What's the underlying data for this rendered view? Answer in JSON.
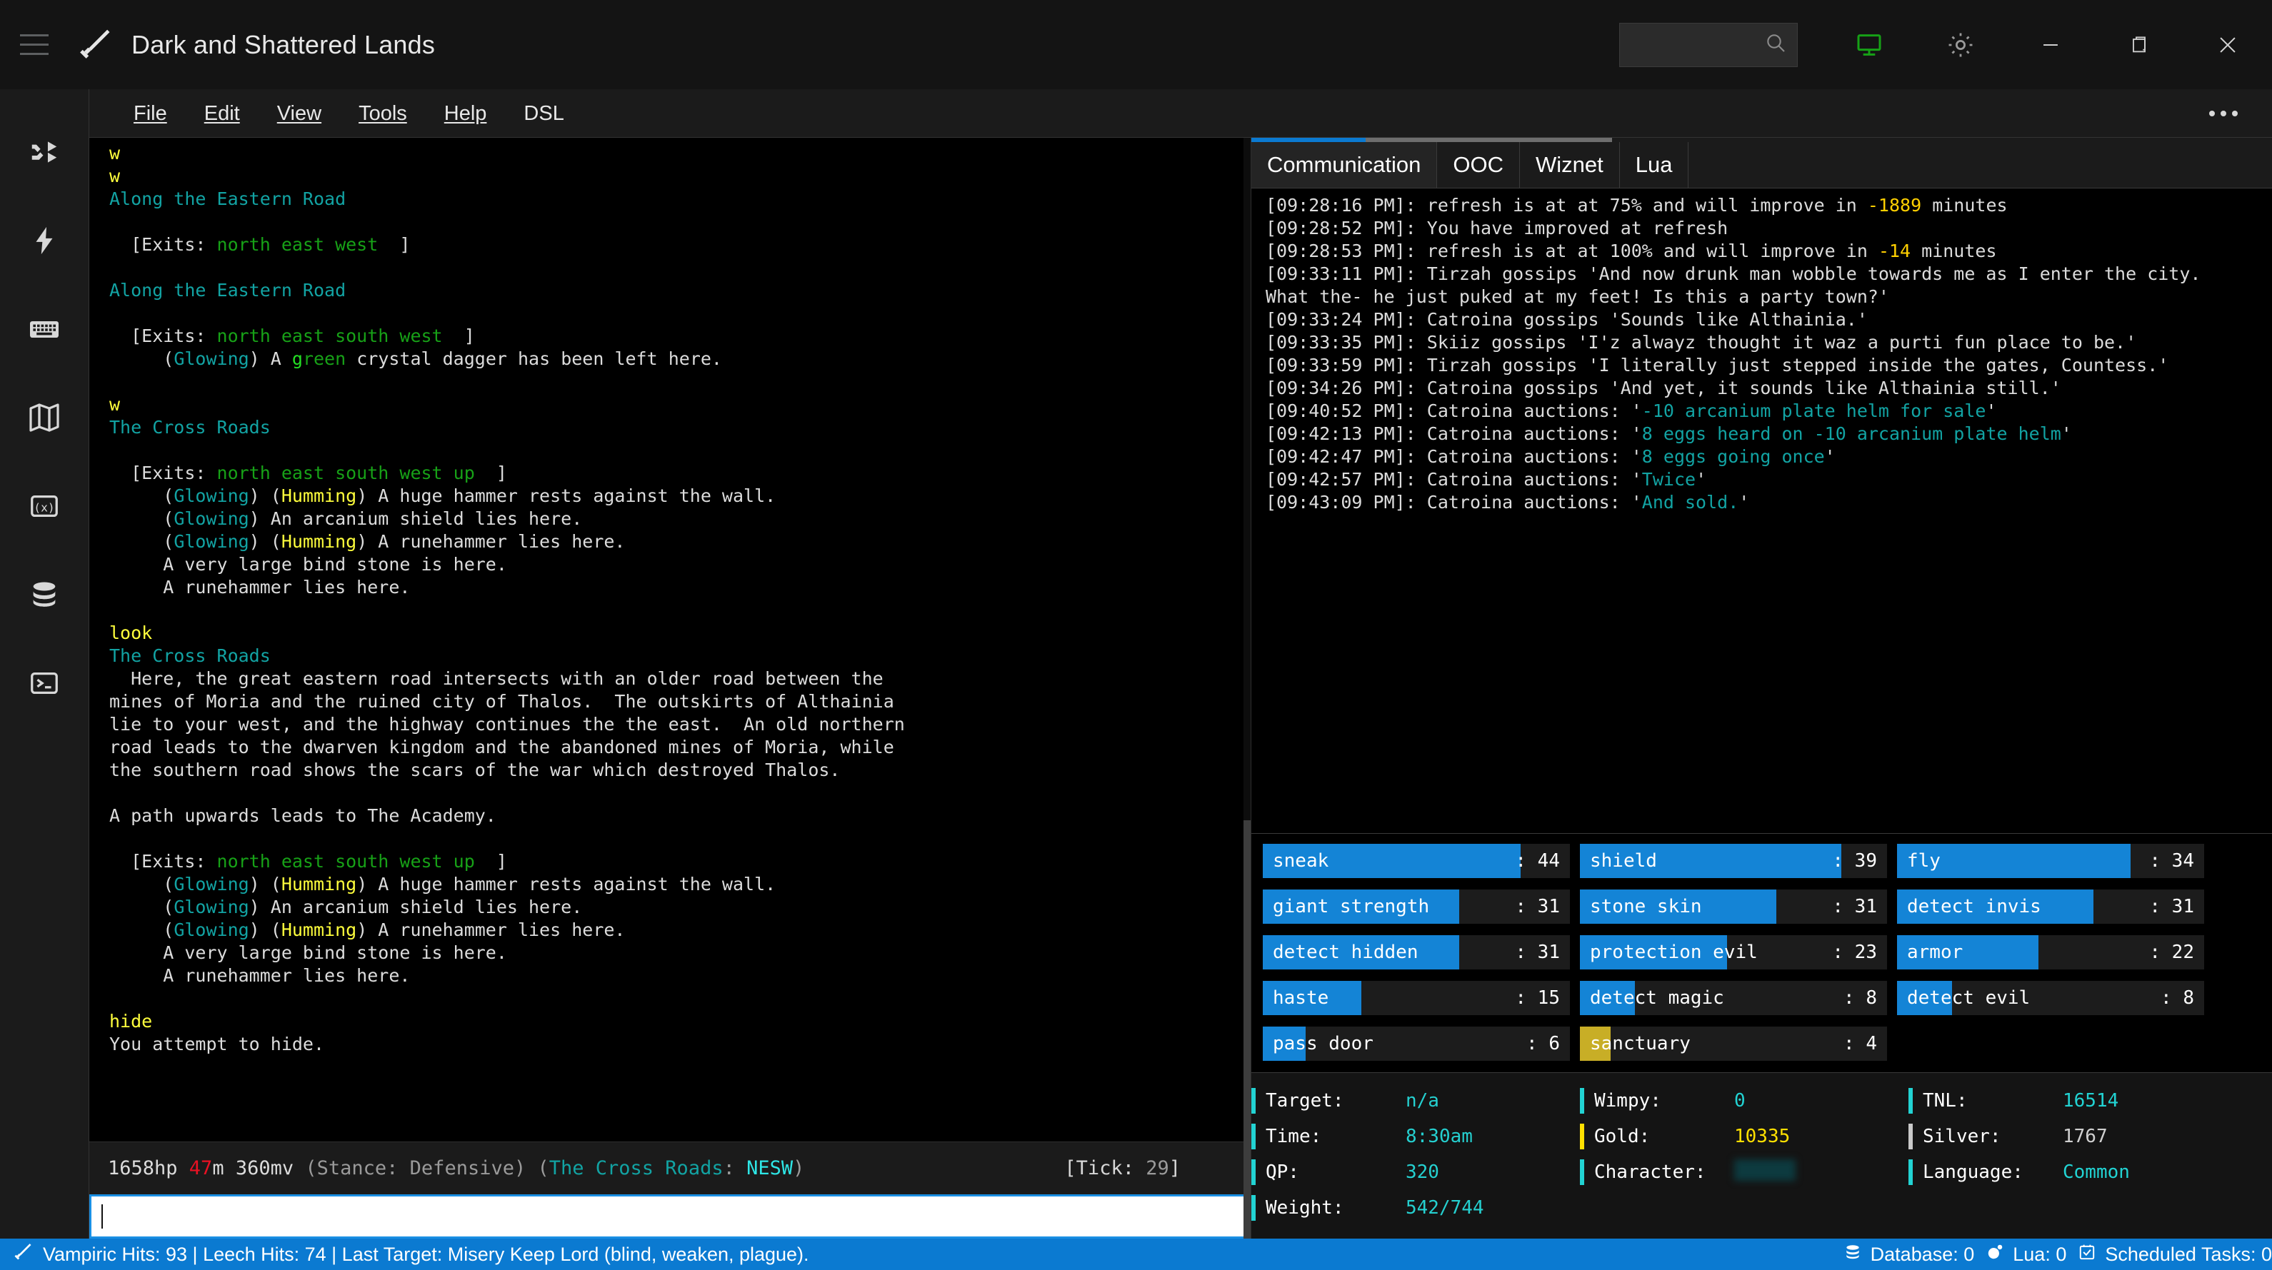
{
  "window": {
    "title": "Dark and Shattered Lands",
    "logo_icon": "sword-icon",
    "hamburger_icon": "hamburger-menu-icon",
    "search_placeholder": "",
    "search_value": "",
    "search_icon": "search-icon",
    "screen_icon": "remote-screen-icon",
    "settings_icon": "gear-icon",
    "minimize_icon": "minimize-icon",
    "restore_icon": "restore-icon",
    "close_icon": "close-icon"
  },
  "rail": {
    "items": [
      {
        "icon": "shuffle-icon",
        "name": "aliases"
      },
      {
        "icon": "lightning-bolt-icon",
        "name": "triggers"
      },
      {
        "icon": "keyboard-icon",
        "name": "keys"
      },
      {
        "icon": "map-icon",
        "name": "mapper"
      },
      {
        "icon": "variable-icon",
        "name": "variables"
      },
      {
        "icon": "database-icon",
        "name": "database"
      },
      {
        "icon": "terminal-icon",
        "name": "lua-console"
      }
    ]
  },
  "menubar": {
    "items": [
      "File",
      "Edit",
      "View",
      "Tools",
      "Help",
      "DSL"
    ],
    "overflow_icon": "ellipsis-icon"
  },
  "mud_output": {
    "lines": [
      [
        {
          "t": "w",
          "c": "c-yellow"
        }
      ],
      [
        {
          "t": "w",
          "c": "c-yellow"
        }
      ],
      [
        {
          "t": "Along the Eastern Road",
          "c": "c-teal"
        }
      ],
      [
        {
          "t": "",
          "c": "c-white"
        }
      ],
      [
        {
          "t": "  [Exits: ",
          "c": "c-white"
        },
        {
          "t": "north east west",
          "c": "c-green"
        },
        {
          "t": "  ]",
          "c": "c-white"
        }
      ],
      [
        {
          "t": "",
          "c": "c-white"
        }
      ],
      [
        {
          "t": "Along the Eastern Road",
          "c": "c-teal"
        }
      ],
      [
        {
          "t": "",
          "c": "c-white"
        }
      ],
      [
        {
          "t": "  [Exits: ",
          "c": "c-white"
        },
        {
          "t": "north east south west",
          "c": "c-green"
        },
        {
          "t": "  ]",
          "c": "c-white"
        }
      ],
      [
        {
          "t": "     (",
          "c": "c-white"
        },
        {
          "t": "Glowing",
          "c": "c-teal"
        },
        {
          "t": ") A ",
          "c": "c-white"
        },
        {
          "t": "g",
          "c": "c-bgreen"
        },
        {
          "t": "reen",
          "c": "c-green"
        },
        {
          "t": " crystal dagger has been left here.",
          "c": "c-white"
        }
      ],
      [
        {
          "t": "",
          "c": "c-white"
        }
      ],
      [
        {
          "t": "w",
          "c": "c-yellow"
        }
      ],
      [
        {
          "t": "The Cross Roads",
          "c": "c-teal"
        }
      ],
      [
        {
          "t": "",
          "c": "c-white"
        }
      ],
      [
        {
          "t": "  [Exits: ",
          "c": "c-white"
        },
        {
          "t": "north east south west up",
          "c": "c-green"
        },
        {
          "t": "  ]",
          "c": "c-white"
        }
      ],
      [
        {
          "t": "     (",
          "c": "c-white"
        },
        {
          "t": "Glowing",
          "c": "c-teal"
        },
        {
          "t": ") (",
          "c": "c-white"
        },
        {
          "t": "Humming",
          "c": "c-yellow"
        },
        {
          "t": ") A huge hammer rests against the wall.",
          "c": "c-white"
        }
      ],
      [
        {
          "t": "     (",
          "c": "c-white"
        },
        {
          "t": "Glowing",
          "c": "c-teal"
        },
        {
          "t": ") An arcanium shield lies here.",
          "c": "c-white"
        }
      ],
      [
        {
          "t": "     (",
          "c": "c-white"
        },
        {
          "t": "Glowing",
          "c": "c-teal"
        },
        {
          "t": ") (",
          "c": "c-white"
        },
        {
          "t": "Humming",
          "c": "c-yellow"
        },
        {
          "t": ") A runehammer lies here.",
          "c": "c-white"
        }
      ],
      [
        {
          "t": "     A very large bind stone is here.",
          "c": "c-white"
        }
      ],
      [
        {
          "t": "     A runehammer lies here.",
          "c": "c-white"
        }
      ],
      [
        {
          "t": "",
          "c": "c-white"
        }
      ],
      [
        {
          "t": "look",
          "c": "c-yellow"
        }
      ],
      [
        {
          "t": "The Cross Roads",
          "c": "c-teal"
        }
      ],
      [
        {
          "t": "  Here, the great eastern road intersects with an older road between the",
          "c": "c-white"
        }
      ],
      [
        {
          "t": "mines of Moria and the ruined city of Thalos.  The outskirts of Althainia",
          "c": "c-white"
        }
      ],
      [
        {
          "t": "lie to your west, and the highway continues the the east.  An old northern",
          "c": "c-white"
        }
      ],
      [
        {
          "t": "road leads to the dwarven kingdom and the abandoned mines of Moria, while",
          "c": "c-white"
        }
      ],
      [
        {
          "t": "the southern road shows the scars of the war which destroyed Thalos.",
          "c": "c-white"
        }
      ],
      [
        {
          "t": "",
          "c": "c-white"
        }
      ],
      [
        {
          "t": "A path upwards leads to The Academy.",
          "c": "c-white"
        }
      ],
      [
        {
          "t": "",
          "c": "c-white"
        }
      ],
      [
        {
          "t": "  [Exits: ",
          "c": "c-white"
        },
        {
          "t": "north east south west up",
          "c": "c-green"
        },
        {
          "t": "  ]",
          "c": "c-white"
        }
      ],
      [
        {
          "t": "     (",
          "c": "c-white"
        },
        {
          "t": "Glowing",
          "c": "c-teal"
        },
        {
          "t": ") (",
          "c": "c-white"
        },
        {
          "t": "Humming",
          "c": "c-yellow"
        },
        {
          "t": ") A huge hammer rests against the wall.",
          "c": "c-white"
        }
      ],
      [
        {
          "t": "     (",
          "c": "c-white"
        },
        {
          "t": "Glowing",
          "c": "c-teal"
        },
        {
          "t": ") An arcanium shield lies here.",
          "c": "c-white"
        }
      ],
      [
        {
          "t": "     (",
          "c": "c-white"
        },
        {
          "t": "Glowing",
          "c": "c-teal"
        },
        {
          "t": ") (",
          "c": "c-white"
        },
        {
          "t": "Humming",
          "c": "c-yellow"
        },
        {
          "t": ") A runehammer lies here.",
          "c": "c-white"
        }
      ],
      [
        {
          "t": "     A very large bind stone is here.",
          "c": "c-white"
        }
      ],
      [
        {
          "t": "     A runehammer lies here.",
          "c": "c-white"
        }
      ],
      [
        {
          "t": "",
          "c": "c-white"
        }
      ],
      [
        {
          "t": "hide",
          "c": "c-yellow"
        }
      ],
      [
        {
          "t": "You attempt to hide.",
          "c": "c-white"
        }
      ]
    ]
  },
  "prompt": {
    "segments": [
      {
        "t": "1658hp ",
        "c": "c-white"
      },
      {
        "t": "47",
        "c": "c-red"
      },
      {
        "t": "m ",
        "c": "c-white"
      },
      {
        "t": "360mv ",
        "c": "c-white"
      },
      {
        "t": "(Stance: Defensive) (",
        "c": "c-gray"
      },
      {
        "t": "The Cross Roads",
        "c": "c-teal"
      },
      {
        "t": ": ",
        "c": "c-gray"
      },
      {
        "t": "NESW",
        "c": "c-cyan"
      },
      {
        "t": ")",
        "c": "c-gray"
      }
    ],
    "tick_label": "[Tick: ",
    "tick_value": "29",
    "tick_suffix": "]",
    "input_value": ""
  },
  "right_panel": {
    "tabs": [
      {
        "label": "Communication",
        "active": true
      },
      {
        "label": "OOC",
        "active": false
      },
      {
        "label": "Wiznet",
        "active": false
      },
      {
        "label": "Lua",
        "active": false
      }
    ],
    "chat_lines": [
      [
        {
          "t": "[09:28:16 PM]: refresh is at at 75% and will improve in ",
          "c": "c-white"
        },
        {
          "t": "-1889",
          "c": "c-goldy"
        },
        {
          "t": " minutes",
          "c": "c-white"
        }
      ],
      [
        {
          "t": "[09:28:52 PM]: You have improved at refresh",
          "c": "c-white"
        }
      ],
      [
        {
          "t": "[09:28:53 PM]: refresh is at at 100% and will improve in ",
          "c": "c-white"
        },
        {
          "t": "-14",
          "c": "c-goldy"
        },
        {
          "t": " minutes",
          "c": "c-white"
        }
      ],
      [
        {
          "t": "[09:33:11 PM]: Tirzah gossips 'And now drunk man wobble towards me as I enter the city.",
          "c": "c-white"
        }
      ],
      [
        {
          "t": "What the- he just puked at my feet! Is this a party town?'",
          "c": "c-white"
        }
      ],
      [
        {
          "t": "[09:33:24 PM]: Catroina gossips 'Sounds like Althainia.'",
          "c": "c-white"
        }
      ],
      [
        {
          "t": "[09:33:35 PM]: Skiiz gossips 'I'z alwayz thought it waz a purti fun place to be.'",
          "c": "c-white"
        }
      ],
      [
        {
          "t": "[09:33:59 PM]: Tirzah gossips 'I literally just stepped inside the gates, Countess.'",
          "c": "c-white"
        }
      ],
      [
        {
          "t": "[09:34:26 PM]: Catroina gossips 'And yet, it sounds like Althainia still.'",
          "c": "c-white"
        }
      ],
      [
        {
          "t": "[09:40:52 PM]: Catroina auctions: '",
          "c": "c-white"
        },
        {
          "t": "-10 arcanium plate helm for sale",
          "c": "c-teal"
        },
        {
          "t": "'",
          "c": "c-white"
        }
      ],
      [
        {
          "t": "[09:42:13 PM]: Catroina auctions: '",
          "c": "c-white"
        },
        {
          "t": "8 eggs heard on -10 arcanium plate helm",
          "c": "c-teal"
        },
        {
          "t": "'",
          "c": "c-white"
        }
      ],
      [
        {
          "t": "[09:42:47 PM]: Catroina auctions: '",
          "c": "c-white"
        },
        {
          "t": "8 eggs going once",
          "c": "c-teal"
        },
        {
          "t": "'",
          "c": "c-white"
        }
      ],
      [
        {
          "t": "[09:42:57 PM]: Catroina auctions: '",
          "c": "c-white"
        },
        {
          "t": "Twice",
          "c": "c-teal"
        },
        {
          "t": "'",
          "c": "c-white"
        }
      ],
      [
        {
          "t": "[09:43:09 PM]: Catroina auctions: '",
          "c": "c-white"
        },
        {
          "t": "And sold.",
          "c": "c-teal"
        },
        {
          "t": "'",
          "c": "c-white"
        }
      ]
    ],
    "affects": [
      {
        "name": "sneak",
        "value": "44",
        "pct": 84,
        "color": "#1484d6"
      },
      {
        "name": "shield",
        "value": "39",
        "pct": 85,
        "color": "#1484d6"
      },
      {
        "name": "fly",
        "value": "34",
        "pct": 76,
        "color": "#1484d6"
      },
      {
        "name": "giant strength",
        "value": "31",
        "pct": 64,
        "color": "#1484d6"
      },
      {
        "name": "stone skin",
        "value": "31",
        "pct": 64,
        "color": "#1484d6"
      },
      {
        "name": "detect invis",
        "value": "31",
        "pct": 64,
        "color": "#1484d6"
      },
      {
        "name": "detect hidden",
        "value": "31",
        "pct": 64,
        "color": "#1484d6"
      },
      {
        "name": "protection evil",
        "value": "23",
        "pct": 48,
        "color": "#1484d6"
      },
      {
        "name": "armor",
        "value": "22",
        "pct": 46,
        "color": "#1484d6"
      },
      {
        "name": "haste",
        "value": "15",
        "pct": 32,
        "color": "#1484d6"
      },
      {
        "name": "detect magic",
        "value": "8",
        "pct": 18,
        "color": "#1484d6"
      },
      {
        "name": "detect evil",
        "value": "8",
        "pct": 18,
        "color": "#1484d6"
      },
      {
        "name": "pass door",
        "value": "6",
        "pct": 14,
        "color": "#1484d6"
      },
      {
        "name": "sanctuary",
        "value": "4",
        "pct": 10,
        "color": "#c8ae26"
      }
    ],
    "stats": {
      "col1": [
        {
          "key": "Target:",
          "value": "n/a",
          "accent": "#22d3d3"
        },
        {
          "key": "Time:",
          "value": "8:30am",
          "accent": "#22d3d3"
        },
        {
          "key": "QP:",
          "value": "320",
          "accent": "#22d3d3"
        },
        {
          "key": "Weight:",
          "value": "542/744",
          "accent": "#22d3d3"
        }
      ],
      "col2": [
        {
          "key": "Wimpy:",
          "value": "0",
          "accent": "#22d3d3",
          "value_color": "#22d3d3"
        },
        {
          "key": "Gold:",
          "value": "10335",
          "accent": "#ffe000",
          "value_color": "#ffe000"
        },
        {
          "key": "Character:",
          "value": "",
          "accent": "#22d3d3",
          "redacted": true
        }
      ],
      "col3": [
        {
          "key": "TNL:",
          "value": "16514",
          "accent": "#22d3d3",
          "value_color": "#22d3d3"
        },
        {
          "key": "Silver:",
          "value": "1767",
          "accent": "#c9c9c9",
          "value_color": "#d0d0d0"
        },
        {
          "key": "Language:",
          "value": "Common",
          "accent": "#22d3d3",
          "value_color": "#22d3d3"
        }
      ]
    }
  },
  "statusbar": {
    "icon": "sword-icon",
    "text": "Vampiric Hits: 93 | Leech Hits: 74 | Last Target: Misery Keep Lord (blind, weaken, plague).",
    "right_items": [
      {
        "icon": "database-icon",
        "label": "Database: 0"
      },
      {
        "icon": "lua-moon-icon",
        "label": "Lua: 0"
      },
      {
        "icon": "checkbox-icon",
        "label": "Scheduled Tasks: 0"
      }
    ]
  },
  "colors": {
    "accent_blue": "#0b7ad1",
    "bar_blue": "#1484d6",
    "bar_gold": "#c8ae26",
    "window_bg": "#141414",
    "terminal_bg": "#000000"
  }
}
